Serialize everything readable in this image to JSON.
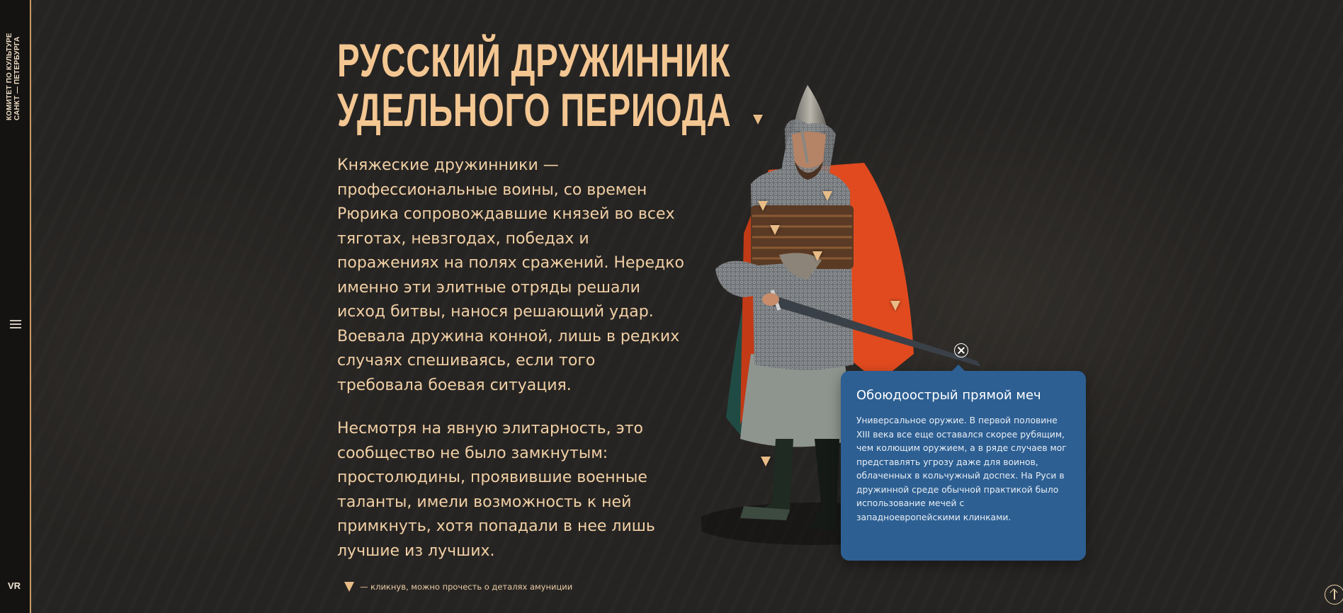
{
  "sidebar": {
    "logo_text": "КОМИТЕТ ПО КУЛЬТУРЕ\nСАНКТ — ПЕТЕРБУРГА",
    "menu_icon": "hamburger-menu-icon",
    "vr_label": "VR"
  },
  "main": {
    "title_line1": "РУССКИЙ ДРУЖИННИК",
    "title_line2": "УДЕЛЬНОГО ПЕРИОДА",
    "paragraph1": "Княжеские дружинники — профессиональные воины, со времен Рюрика сопровождавшие князей во всех тяготах, невзгодах, победах и поражениях на полях сражений. Нередко именно эти элитные отряды решали исход битвы, нанося решающий удар. Воевала дружина конной, лишь в редких случаях спешиваясь, если того требовала боевая ситуация.",
    "paragraph2": "Несмотря на явную элитарность, это сообщество не было замкнутым: простолюдины, проявившие военные таланты, имели возможность к ней примкнуть, хотя попадали в нее лишь лучшие из лучших.",
    "hint_text": "— кликнув, можно прочесть о деталях амуниции"
  },
  "popup": {
    "title": "Обоюдоострый прямой меч",
    "body": "Универсальное оружие. В первой половине XIII века все еще оставался скорее рубящим, чем колющим оружием, а в ряде случаев мог представлять угрозу даже для воинов, облаченных в кольчужный доспех. На Руси в дружинной среде обычной практикой было использование мечей с западноевропейскими клинками."
  },
  "colors": {
    "accent": "#f3c692",
    "popup_bg": "#2d5f92",
    "marker": "#e7bc86",
    "cloak": "#e04a1e"
  },
  "icons": {
    "close": "close-icon",
    "scroll_up": "arrow-up-icon",
    "marker": "triangle-marker-icon"
  }
}
